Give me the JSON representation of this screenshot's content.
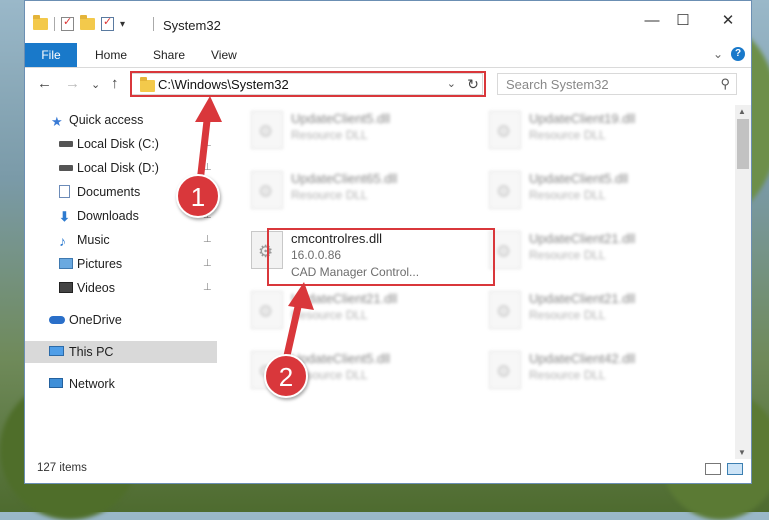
{
  "window": {
    "title": "System32",
    "qa_dropdown": "▾",
    "minimize": "—",
    "maximize": "☐",
    "close": "✕"
  },
  "ribbon": {
    "tabs": [
      "File",
      "Home",
      "Share",
      "View"
    ],
    "collapse": "⌄",
    "help": "?"
  },
  "nav": {
    "back": "←",
    "forward": "→",
    "recent": "⌄",
    "up": "↑",
    "address": "C:\\Windows\\System32",
    "address_dropdown": "⌄",
    "refresh": "↻",
    "search_placeholder": "Search System32",
    "search_icon": "⚲"
  },
  "sidebar": {
    "items": [
      {
        "label": "Quick access",
        "icon": "star-icon",
        "pinned": false
      },
      {
        "label": "Local Disk (C:)",
        "icon": "drive-icon",
        "pinned": true
      },
      {
        "label": "Local Disk (D:)",
        "icon": "drive-icon",
        "pinned": true
      },
      {
        "label": "Documents",
        "icon": "documents-icon",
        "pinned": true
      },
      {
        "label": "Downloads",
        "icon": "downloads-icon",
        "pinned": true
      },
      {
        "label": "Music",
        "icon": "music-icon",
        "pinned": true
      },
      {
        "label": "Pictures",
        "icon": "pictures-icon",
        "pinned": true
      },
      {
        "label": "Videos",
        "icon": "videos-icon",
        "pinned": true
      },
      {
        "label": "OneDrive",
        "icon": "cloud-icon",
        "pinned": false
      },
      {
        "label": "This PC",
        "icon": "computer-icon",
        "pinned": false,
        "selected": true
      },
      {
        "label": "Network",
        "icon": "network-icon",
        "pinned": false
      }
    ],
    "pin_glyph": "📌"
  },
  "files": {
    "left": [
      {
        "name": "UpdateClient5.dll",
        "desc": "Resource DLL"
      },
      {
        "name": "UpdateClient65.dll",
        "desc": "Resource DLL"
      },
      {
        "name": "cmcontrolres.dll",
        "desc": "16.0.0.86",
        "desc2": "CAD Manager Control..."
      },
      {
        "name": "UpdateClient21.dll",
        "desc": "Resource DLL"
      },
      {
        "name": "UpdateClient5.dll",
        "desc": "Resource DLL"
      }
    ],
    "right": [
      {
        "name": "UpdateClient19.dll",
        "desc": "Resource DLL"
      },
      {
        "name": "UpdateClient5.dll",
        "desc": "Resource DLL"
      },
      {
        "name": "UpdateClient21.dll",
        "desc": "Resource DLL"
      },
      {
        "name": "UpdateClient21.dll",
        "desc": "Resource DLL"
      },
      {
        "name": "UpdateClient42.dll",
        "desc": "Resource DLL"
      }
    ]
  },
  "status": {
    "item_count": "127 items"
  },
  "callouts": [
    "1",
    "2"
  ],
  "colors": {
    "accent": "#1979ca",
    "highlight": "#d9373b"
  }
}
